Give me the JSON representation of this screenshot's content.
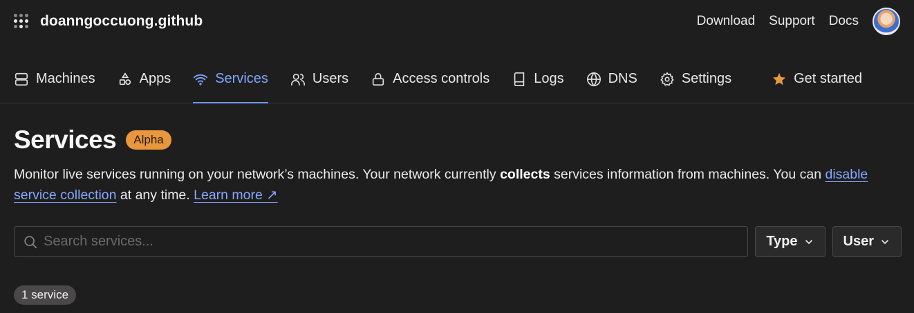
{
  "header": {
    "org_name": "doanngoccuong.github",
    "links": [
      {
        "label": "Download"
      },
      {
        "label": "Support"
      },
      {
        "label": "Docs"
      }
    ]
  },
  "nav": {
    "items": [
      {
        "label": "Machines",
        "icon": "server-icon"
      },
      {
        "label": "Apps",
        "icon": "apps-icon"
      },
      {
        "label": "Services",
        "icon": "wifi-icon",
        "active": true
      },
      {
        "label": "Users",
        "icon": "users-icon"
      },
      {
        "label": "Access controls",
        "icon": "lock-icon"
      },
      {
        "label": "Logs",
        "icon": "book-icon"
      },
      {
        "label": "DNS",
        "icon": "globe-icon"
      },
      {
        "label": "Settings",
        "icon": "gear-icon"
      }
    ],
    "get_started": {
      "label": "Get started",
      "icon": "star-icon"
    }
  },
  "page": {
    "title": "Services",
    "badge": "Alpha",
    "desc_part1": "Monitor live services running on your network’s machines. Your network currently ",
    "desc_bold": "collects",
    "desc_part2": " services information from machines. You can ",
    "desc_link1": "disable service collection",
    "desc_part3": " at any time. ",
    "desc_link2": "Learn more ↗"
  },
  "filters": {
    "search_placeholder": "Search services...",
    "search_value": "",
    "type_label": "Type",
    "user_label": "User"
  },
  "results": {
    "count_label": "1 service"
  },
  "colors": {
    "background": "#1f1e1e",
    "accent": "#7ea6ff",
    "alpha_badge": "#e8973d",
    "star": "#e8973d"
  }
}
